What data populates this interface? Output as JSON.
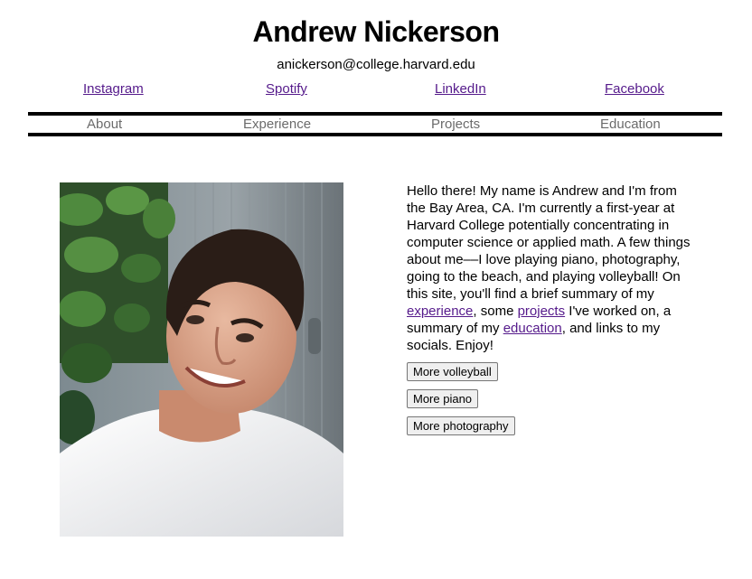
{
  "header": {
    "name": "Andrew Nickerson",
    "email": "anickerson@college.harvard.edu"
  },
  "socials": [
    {
      "label": "Instagram"
    },
    {
      "label": "Spotify"
    },
    {
      "label": "LinkedIn"
    },
    {
      "label": "Facebook"
    }
  ],
  "nav": [
    {
      "label": "About"
    },
    {
      "label": "Experience"
    },
    {
      "label": "Projects"
    },
    {
      "label": "Education"
    }
  ],
  "bio": {
    "part1": "Hello there! My name is Andrew and I'm from the Bay Area, CA. I'm currently a first-year at Harvard College potentially concentrating in computer science or applied math. A few things about me––I love playing piano, photography, going to the beach, and playing volleyball! On this site, you'll find a brief summary of my ",
    "link_experience": "experience",
    "part2": ", some ",
    "link_projects": "projects",
    "part3": " I've worked on, a summary of my ",
    "link_education": "education",
    "part4": ", and links to my socials. Enjoy!"
  },
  "buttons": [
    {
      "label": "More volleyball"
    },
    {
      "label": "More piano"
    },
    {
      "label": "More photography"
    }
  ],
  "colors": {
    "link_visited": "#551a8b",
    "nav_text": "#6b6b6b",
    "rule": "#000000"
  }
}
